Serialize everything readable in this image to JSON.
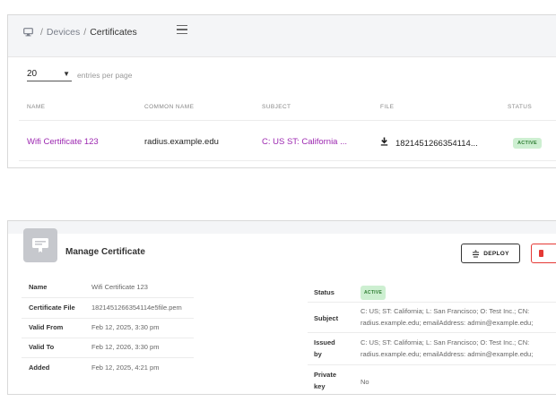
{
  "breadcrumb": {
    "devices": "Devices",
    "separator": "/",
    "current": "Certificates"
  },
  "pagination": {
    "page_size": "20",
    "label": "entries per page"
  },
  "table": {
    "columns": [
      "NAME",
      "COMMON NAME",
      "SUBJECT",
      "FILE",
      "STATUS"
    ],
    "rows": [
      {
        "name": "Wifi Certificate 123",
        "common_name": "radius.example.edu",
        "subject": "C: US ST: California ...",
        "file": "1821451266354114...",
        "status": "ACTIVE"
      }
    ]
  },
  "manage": {
    "title": "Manage Certificate",
    "deploy_label": "DEPLOY",
    "details": [
      {
        "label": "Name",
        "value": "Wifi Certificate 123"
      },
      {
        "label": "Certificate File",
        "value": "1821451266354114e5file.pem"
      },
      {
        "label": "Valid From",
        "value": "Feb 12, 2025, 3:30 pm"
      },
      {
        "label": "Valid To",
        "value": "Feb 12, 2026, 3:30 pm"
      },
      {
        "label": "Added",
        "value": "Feb 12, 2025, 4:21 pm"
      }
    ],
    "status": {
      "label": "Status",
      "value": "ACTIVE"
    },
    "subject": {
      "label": "Subject",
      "line1": "C: US;  ST: California;  L: San Francisco;  O: Test Inc.;  CN:",
      "line2": "radius.example.edu;  emailAddress: admin@example.edu;"
    },
    "issued_by": {
      "label_1": "Issued",
      "label_2": "by",
      "line1": "C: US;  ST: California;  L: San Francisco;  O: Test Inc.;  CN:",
      "line2": "radius.example.edu;  emailAddress: admin@example.edu;"
    },
    "private_key": {
      "label_1": "Private",
      "label_2": "key",
      "value": "No"
    }
  },
  "colors": {
    "accent": "#9c27b0",
    "active_bg": "#cdefd1",
    "active_text": "#2e7d32",
    "danger": "#e53935"
  },
  "icons": [
    "monitor-icon",
    "menu-icon",
    "caret-down-icon",
    "download-icon",
    "certificate-icon",
    "deploy-icon",
    "trash-icon"
  ]
}
